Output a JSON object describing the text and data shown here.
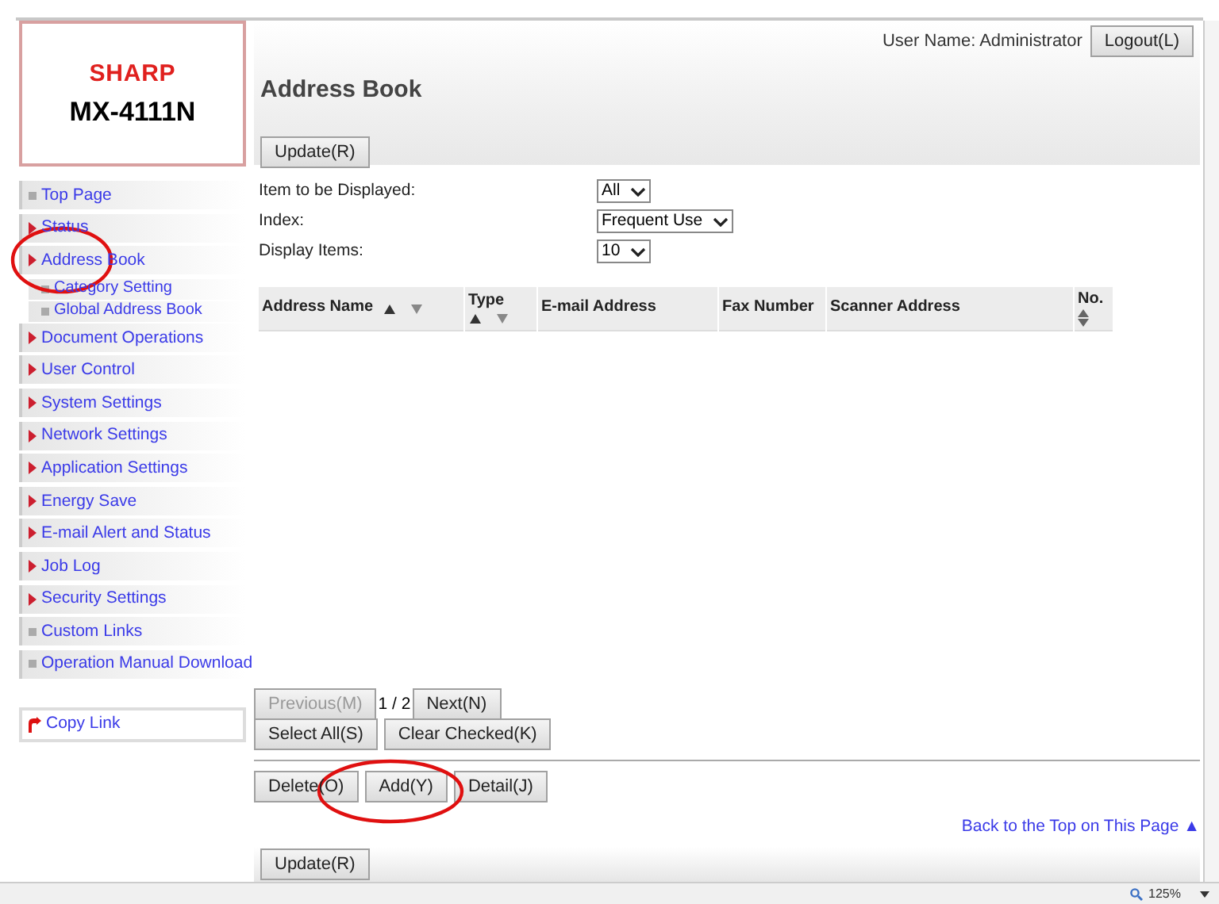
{
  "logo": {
    "brand": "SHARP",
    "model": "MX-4111N"
  },
  "header": {
    "user_name": "User Name: Administrator",
    "logout": "Logout(L)",
    "title": "Address Book",
    "update": "Update(R)"
  },
  "sidebar": {
    "items": [
      {
        "label": "Top Page",
        "kind": "link"
      },
      {
        "label": "Status",
        "kind": "menu"
      },
      {
        "label": "Address Book",
        "kind": "menu",
        "children": [
          {
            "label": "Category Setting",
            "kind": "link"
          },
          {
            "label": "Global Address Book",
            "kind": "link"
          }
        ]
      },
      {
        "label": "Document Operations",
        "kind": "menu"
      },
      {
        "label": "User Control",
        "kind": "menu"
      },
      {
        "label": "System Settings",
        "kind": "menu"
      },
      {
        "label": "Network Settings",
        "kind": "menu"
      },
      {
        "label": "Application Settings",
        "kind": "menu"
      },
      {
        "label": "Energy Save",
        "kind": "menu"
      },
      {
        "label": "E-mail Alert and Status",
        "kind": "menu"
      },
      {
        "label": "Job Log",
        "kind": "menu"
      },
      {
        "label": "Security Settings",
        "kind": "menu"
      },
      {
        "label": "Custom Links",
        "kind": "link"
      },
      {
        "label": "Operation Manual Download",
        "kind": "link"
      }
    ],
    "copy_link": "Copy Link"
  },
  "filters": [
    {
      "label": "Item to be Displayed:",
      "value": "All"
    },
    {
      "label": "Index:",
      "value": "Frequent Use"
    },
    {
      "label": "Display Items:",
      "value": "10"
    }
  ],
  "table": {
    "columns": [
      {
        "label": "Address Name",
        "kind": "sort-inline"
      },
      {
        "label": "Type",
        "kind": "sort-below"
      },
      {
        "label": "E-mail Address",
        "kind": "plain"
      },
      {
        "label": "Fax Number",
        "kind": "plain"
      },
      {
        "label": "Scanner Address",
        "kind": "plain"
      },
      {
        "label": "No.",
        "kind": "sort-double"
      }
    ]
  },
  "pager": {
    "previous": {
      "label": "Previous(M)",
      "disabled": true
    },
    "page": "1 / 2",
    "next": {
      "label": "Next(N)",
      "disabled": false
    }
  },
  "selection_buttons": [
    "Select All(S)",
    "Clear Checked(K)"
  ],
  "action_buttons": [
    "Delete(O)",
    "Add(Y)",
    "Detail(J)"
  ],
  "back_to_top": "Back to the Top on This Page ▲",
  "footer_update": "Update(R)",
  "status_bar": {
    "zoom": "125%"
  }
}
